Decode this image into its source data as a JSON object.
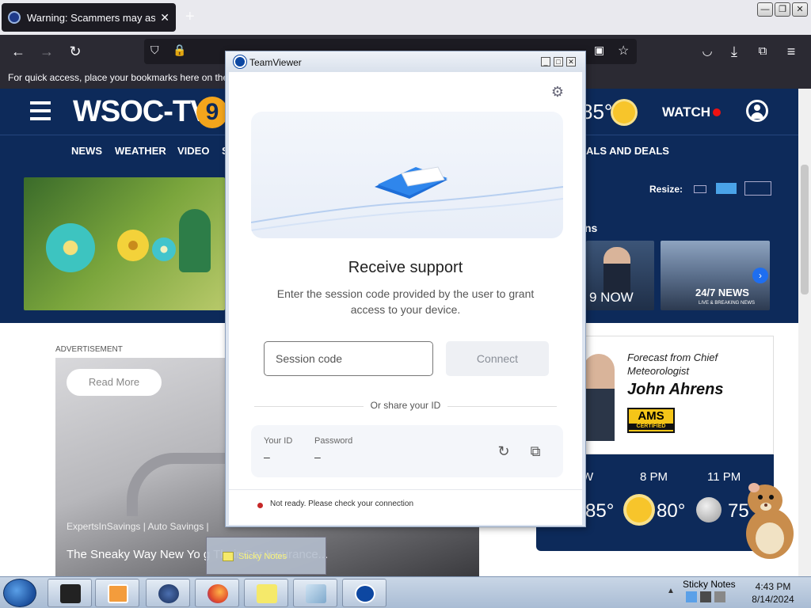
{
  "browser": {
    "tab_title": "Warning: Scammers may ask yo",
    "tab_close": "✕",
    "new_tab": "+",
    "bookmarks_hint": "For quick access, place your bookmarks here on the",
    "window_controls": [
      "—",
      "❐",
      "✕"
    ]
  },
  "site": {
    "logo_text": "WSOC-TV",
    "logo_mark": "9",
    "temperature": "85°",
    "watch_label": "WATCH",
    "nav_items": [
      "NEWS",
      "WEATHER",
      "VIDEO",
      "S",
      "ALS AND DEALS"
    ],
    "resize_label": "Resize:",
    "news_section_label": "ns",
    "thumb_now_label": "9 NOW",
    "thumb_247_label": "24/7 NEWS",
    "thumb_247_sub": "LIVE & BREAKING NEWS",
    "ad_label": "ADVERTISEMENT",
    "ad_read_more": "Read More",
    "ad_source": "ExpertsInSavings | Auto Savings |",
    "ad_headline": "The Sneaky Way New Yo                    g Their Car Insurance...",
    "forecast_label": "Forecast from Chief Meteorologist",
    "forecast_name": "John Ahrens",
    "ams_text": "AMS",
    "ams_sub": "CERTIFIED",
    "weather_times": [
      "W",
      "8 PM",
      "11 PM"
    ],
    "weather_temps": [
      "85°",
      "80°",
      "75"
    ]
  },
  "teamviewer": {
    "title": "TeamViewer",
    "heading": "Receive support",
    "description": "Enter the session code provided by the user to grant access to your device.",
    "session_placeholder": "Session code",
    "connect_label": "Connect",
    "or_share": "Or share your ID",
    "your_id_label": "Your ID",
    "your_id_value": "–",
    "password_label": "Password",
    "password_value": "–",
    "status": "Not ready. Please check your connection",
    "status_color": "#c62828"
  },
  "sticky": {
    "label": "Sticky Notes"
  },
  "taskbar": {
    "tray_label": "Sticky Notes",
    "time": "4:43 PM",
    "date": "8/14/2024"
  }
}
